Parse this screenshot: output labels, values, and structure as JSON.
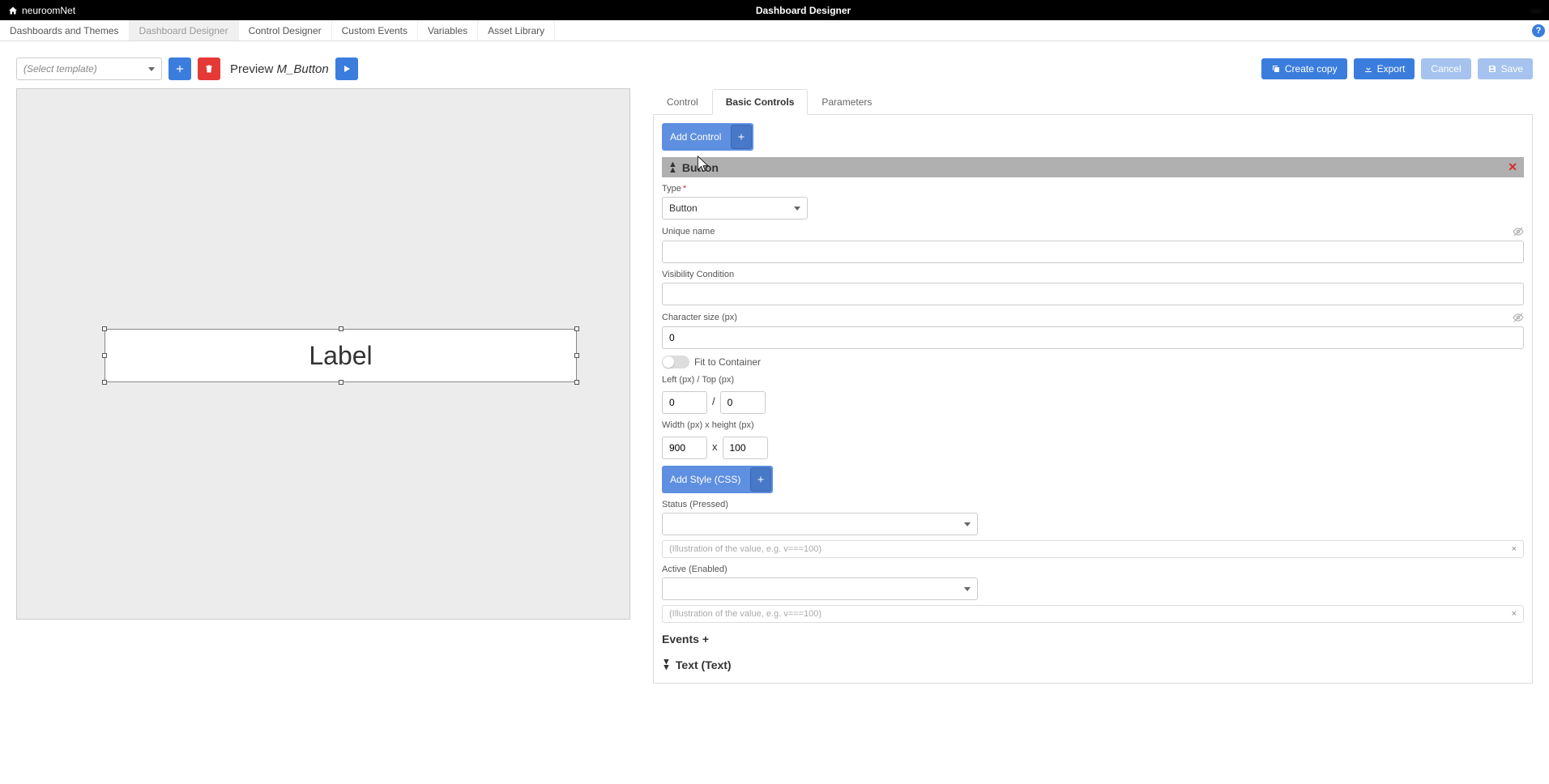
{
  "topbar": {
    "brand": "neuroomNet",
    "title": "Dashboard Designer",
    "user": "—"
  },
  "nav": {
    "items": [
      "Dashboards and Themes",
      "Dashboard Designer",
      "Control Designer",
      "Custom Events",
      "Variables",
      "Asset Library"
    ],
    "activeIndex": 1
  },
  "toolbar": {
    "templatePlaceholder": "(Select template)",
    "previewLabel": "Preview",
    "previewTarget": "M_Button",
    "createCopy": "Create copy",
    "export": "Export",
    "cancel": "Cancel",
    "save": "Save"
  },
  "canvas": {
    "itemText": "Label"
  },
  "panel": {
    "tabs": [
      "Control",
      "Basic Controls",
      "Parameters"
    ],
    "activeTab": 1,
    "addControl": "Add Control",
    "sections": {
      "button": {
        "title": "Button",
        "fields": {
          "typeLabel": "Type",
          "typeValue": "Button",
          "uniqueNameLabel": "Unique name",
          "uniqueNameValue": "",
          "visibilityLabel": "Visibility Condition",
          "visibilityValue": "",
          "charSizeLabel": "Character size (px)",
          "charSizeValue": "0",
          "fitToContainerLabel": "Fit to Container",
          "leftTopLabel": "Left (px) / Top (px)",
          "leftValue": "0",
          "topValue": "0",
          "widthHeightLabel": "Width (px) x height (px)",
          "widthValue": "900",
          "heightValue": "100",
          "addStyleLabel": "Add Style (CSS)",
          "statusLabel": "Status (Pressed)",
          "statusValue": "",
          "illustPlaceholder": "(Illustration of the value, e.g. v===100)",
          "activeLabel": "Active (Enabled)",
          "activeValue": ""
        }
      },
      "events": {
        "title": "Events"
      },
      "text": {
        "title": "Text (Text)"
      }
    }
  }
}
